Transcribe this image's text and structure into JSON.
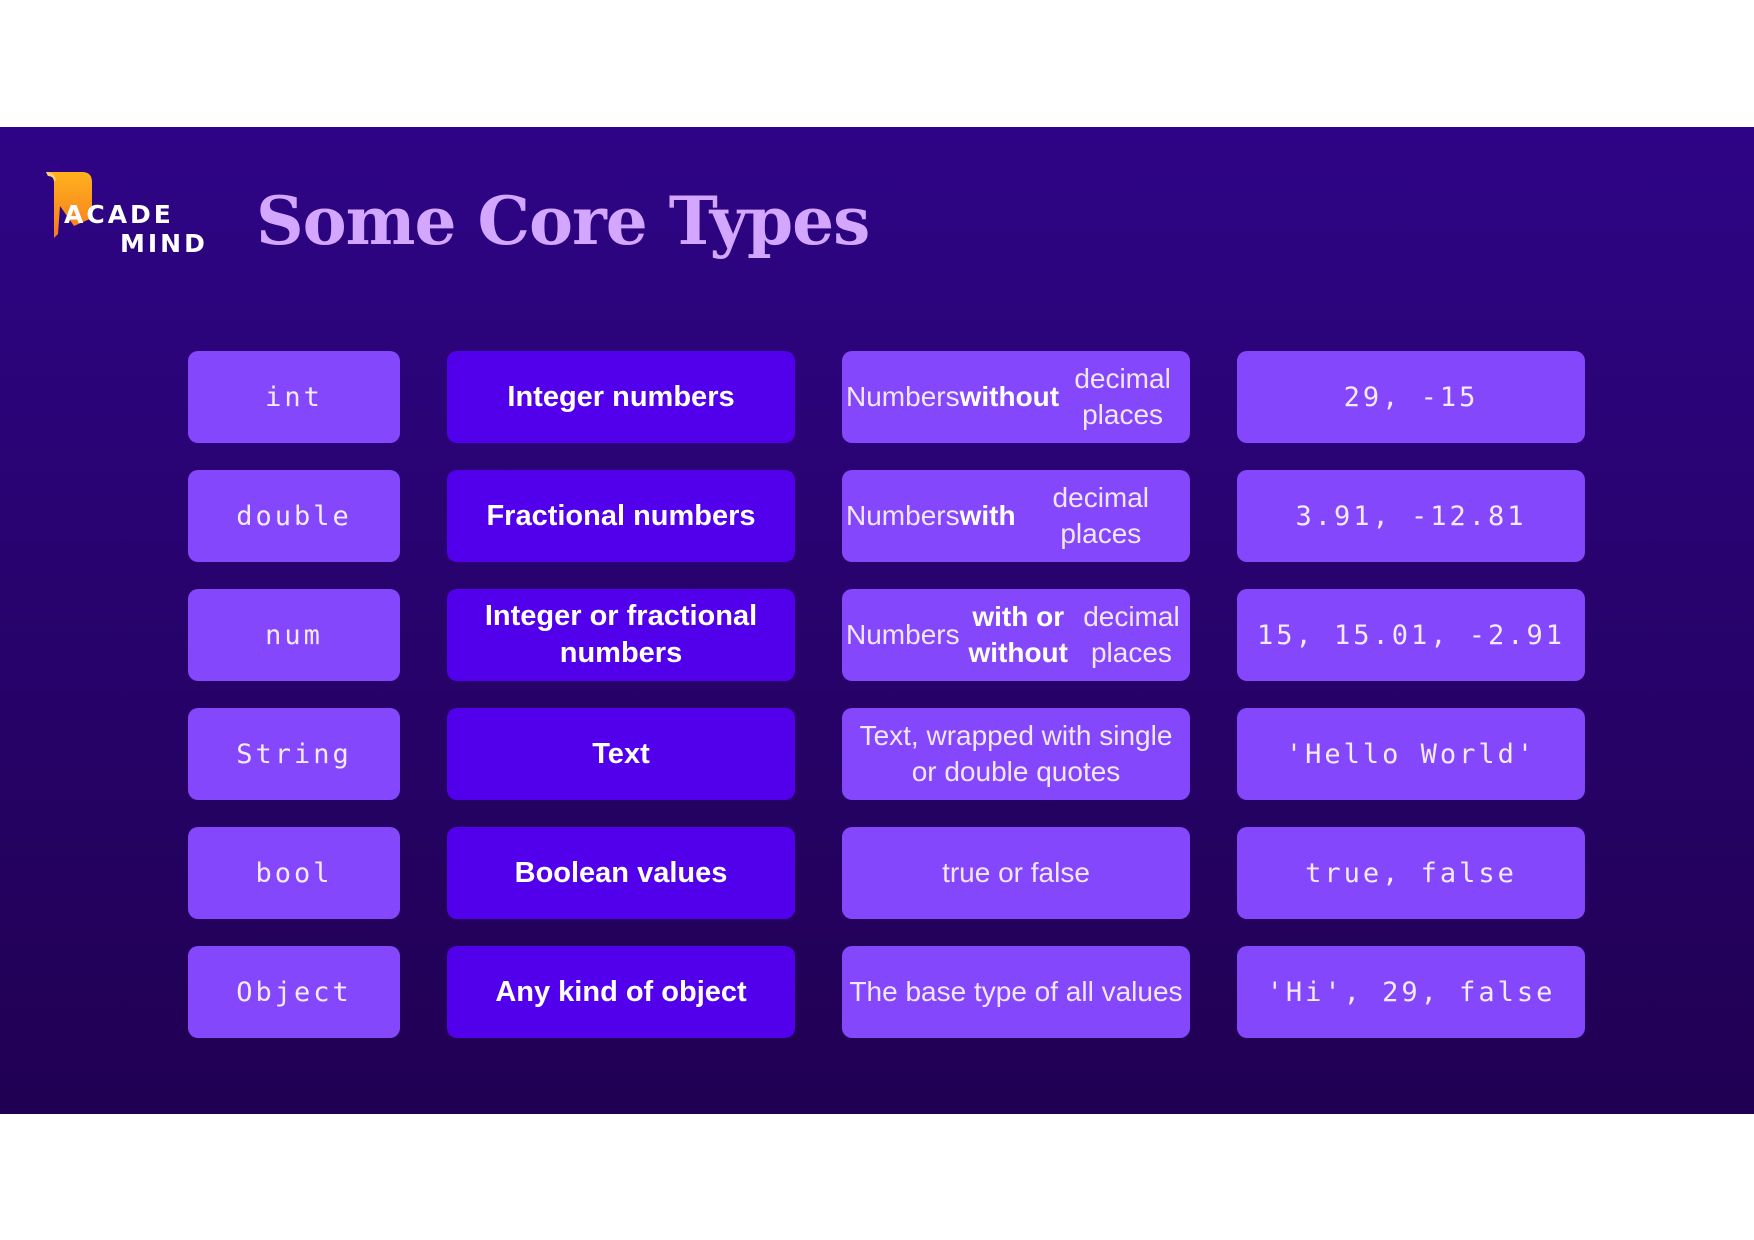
{
  "logo": {
    "line1": "ACADE",
    "line2": "MIND"
  },
  "title": "Some Core Types",
  "rows": [
    {
      "type": "int",
      "label": "Integer numbers",
      "desc": [
        {
          "t": "Numbers ",
          "b": false
        },
        {
          "t": "without",
          "b": true
        },
        {
          "t": " decimal places",
          "b": false
        }
      ],
      "example": "29, -15"
    },
    {
      "type": "double",
      "label": "Fractional numbers",
      "desc": [
        {
          "t": "Numbers ",
          "b": false
        },
        {
          "t": "with",
          "b": true
        },
        {
          "t": " decimal places",
          "b": false
        }
      ],
      "example": "3.91, -12.81"
    },
    {
      "type": "num",
      "label": "Integer or fractional numbers",
      "desc": [
        {
          "t": "Numbers ",
          "b": false
        },
        {
          "t": "with or without",
          "b": true
        },
        {
          "t": " decimal places",
          "b": false
        }
      ],
      "example": "15, 15.01, -2.91"
    },
    {
      "type": "String",
      "label": "Text",
      "desc": [
        {
          "t": "Text, wrapped with single or double quotes",
          "b": false
        }
      ],
      "example": "'Hello World'"
    },
    {
      "type": "bool",
      "label": "Boolean values",
      "desc": [
        {
          "t": "true or false",
          "b": false
        }
      ],
      "example": "true, false"
    },
    {
      "type": "Object",
      "label": "Any kind of object",
      "desc": [
        {
          "t": "The base type of all values",
          "b": false
        }
      ],
      "example": "'Hi', 29, false"
    }
  ]
}
